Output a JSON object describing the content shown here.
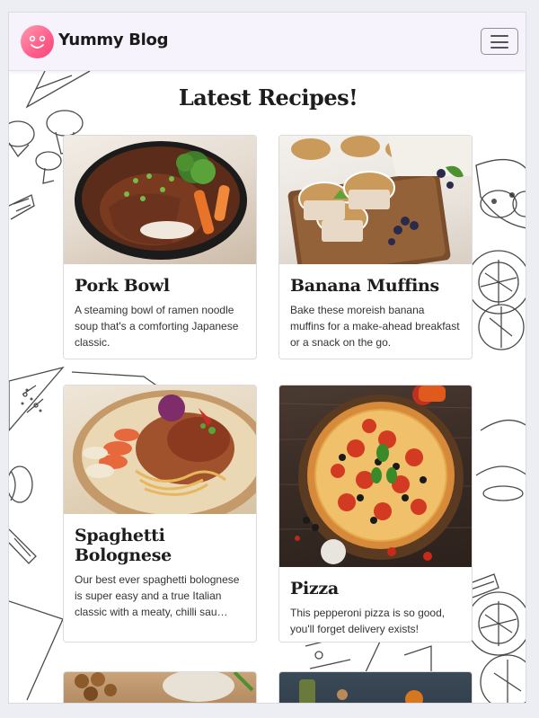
{
  "navbar": {
    "brand": "Yummy Blog",
    "logo_icon": "smiley-face-logo-icon",
    "menu_icon": "hamburger-menu-icon"
  },
  "page": {
    "heading": "Latest Recipes!"
  },
  "recipes": [
    {
      "title": "Pork Bowl",
      "description": "A steaming bowl of ramen noodle soup that's a comforting Japanese classic.",
      "image": "pork-bowl-photo"
    },
    {
      "title": "Banana Muffins",
      "description": "Bake these moreish banana muffins for a make-ahead breakfast or a snack on the go.",
      "image": "banana-muffins-photo"
    },
    {
      "title": "Spaghetti Bolognese",
      "description": "Our best ever spaghetti bolognese is super easy and a true Italian classic with a meaty, chilli sau…",
      "image": "spaghetti-bolognese-photo"
    },
    {
      "title": "Pizza",
      "description": "This pepperoni pizza is so good, you'll forget delivery exists!",
      "image": "pizza-photo"
    }
  ],
  "colors": {
    "navbar_bg": "#f6f3fc",
    "logo_gradient_start": "#ff9ab0",
    "logo_gradient_end": "#f7467a",
    "text": "#1d1d1d"
  }
}
